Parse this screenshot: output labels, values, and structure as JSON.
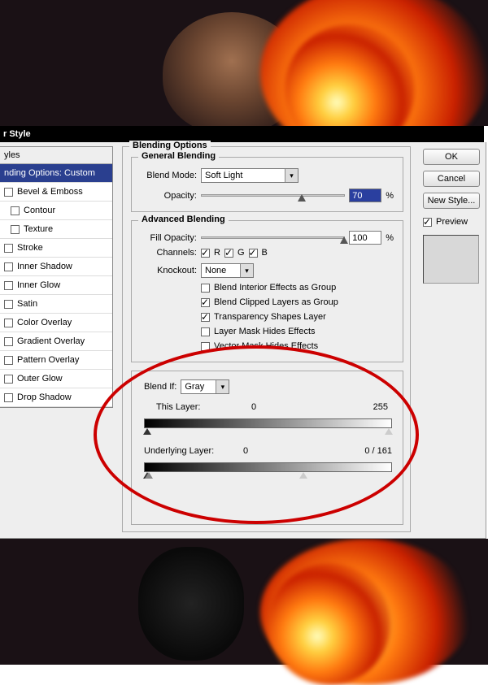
{
  "window_title": "r Style",
  "styles_header": "yles",
  "style_items": [
    "nding Options: Custom",
    "Bevel & Emboss",
    "Contour",
    "Texture",
    "Stroke",
    "Inner Shadow",
    "Inner Glow",
    "Satin",
    "Color Overlay",
    "Gradient Overlay",
    "Pattern Overlay",
    "Outer Glow",
    "Drop Shadow"
  ],
  "blending": {
    "section_title": "Blending Options",
    "general_title": "General Blending",
    "blend_mode_label": "Blend Mode:",
    "blend_mode_value": "Soft Light",
    "opacity_label": "Opacity:",
    "opacity_value": "70",
    "opacity_pct": "%",
    "advanced_title": "Advanced Blending",
    "fill_opacity_label": "Fill Opacity:",
    "fill_opacity_value": "100",
    "fill_opacity_pct": "%",
    "channels_label": "Channels:",
    "ch_r": "R",
    "ch_g": "G",
    "ch_b": "B",
    "knockout_label": "Knockout:",
    "knockout_value": "None",
    "opt1": "Blend Interior Effects as Group",
    "opt2": "Blend Clipped Layers as Group",
    "opt3": "Transparency Shapes Layer",
    "opt4": "Layer Mask Hides Effects",
    "opt5": "Vector Mask Hides Effects",
    "blend_if_label": "Blend If:",
    "blend_if_value": "Gray",
    "this_layer_label": "This Layer:",
    "this_low": "0",
    "this_high": "255",
    "under_label": "Underlying Layer:",
    "under_low": "0",
    "under_high_split": "0   /   161"
  },
  "buttons": {
    "ok": "OK",
    "cancel": "Cancel",
    "new_style": "New Style...",
    "preview": "Preview"
  }
}
